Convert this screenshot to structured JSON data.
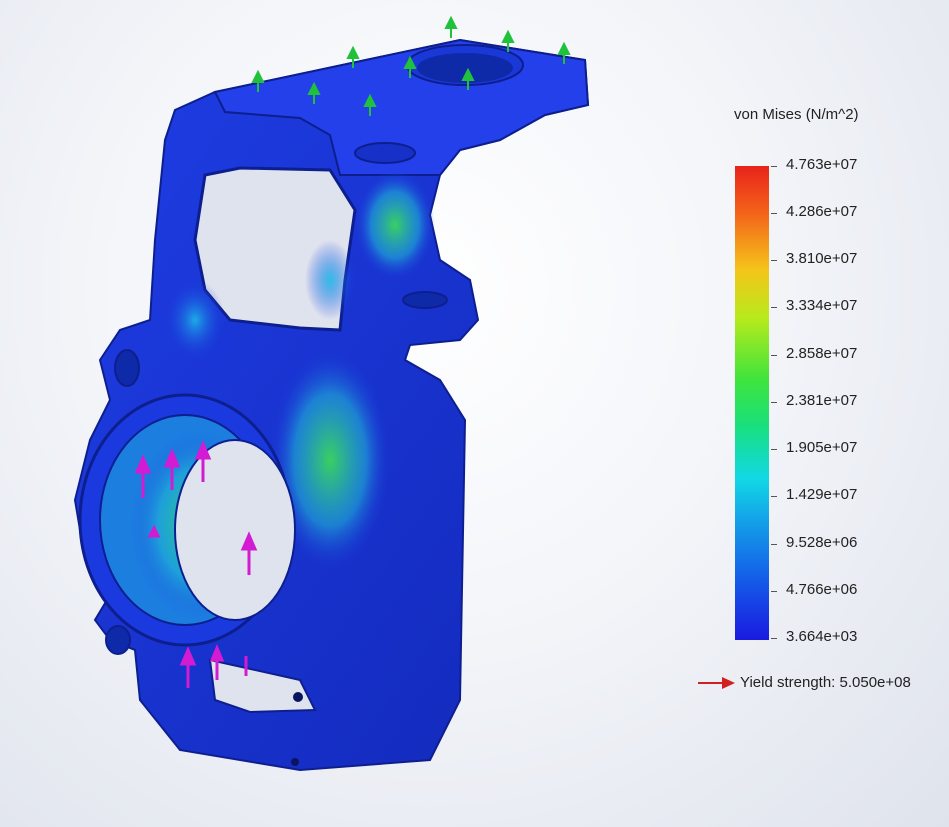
{
  "legend": {
    "title": "von Mises (N/m^2)",
    "labels": [
      "4.763e+07",
      "4.286e+07",
      "3.810e+07",
      "3.334e+07",
      "2.858e+07",
      "2.381e+07",
      "1.905e+07",
      "1.429e+07",
      "9.528e+06",
      "4.766e+06",
      "3.664e+03"
    ],
    "yield_text": "Yield strength: 5.050e+08"
  },
  "colors": {
    "max": "#e8231a",
    "min": "#1a1ae0",
    "body": "#1a3ae0",
    "fixture_arrow": "#1fc23a",
    "load_arrow": "#d21bd2",
    "yield_arrow": "#d21f1f"
  }
}
